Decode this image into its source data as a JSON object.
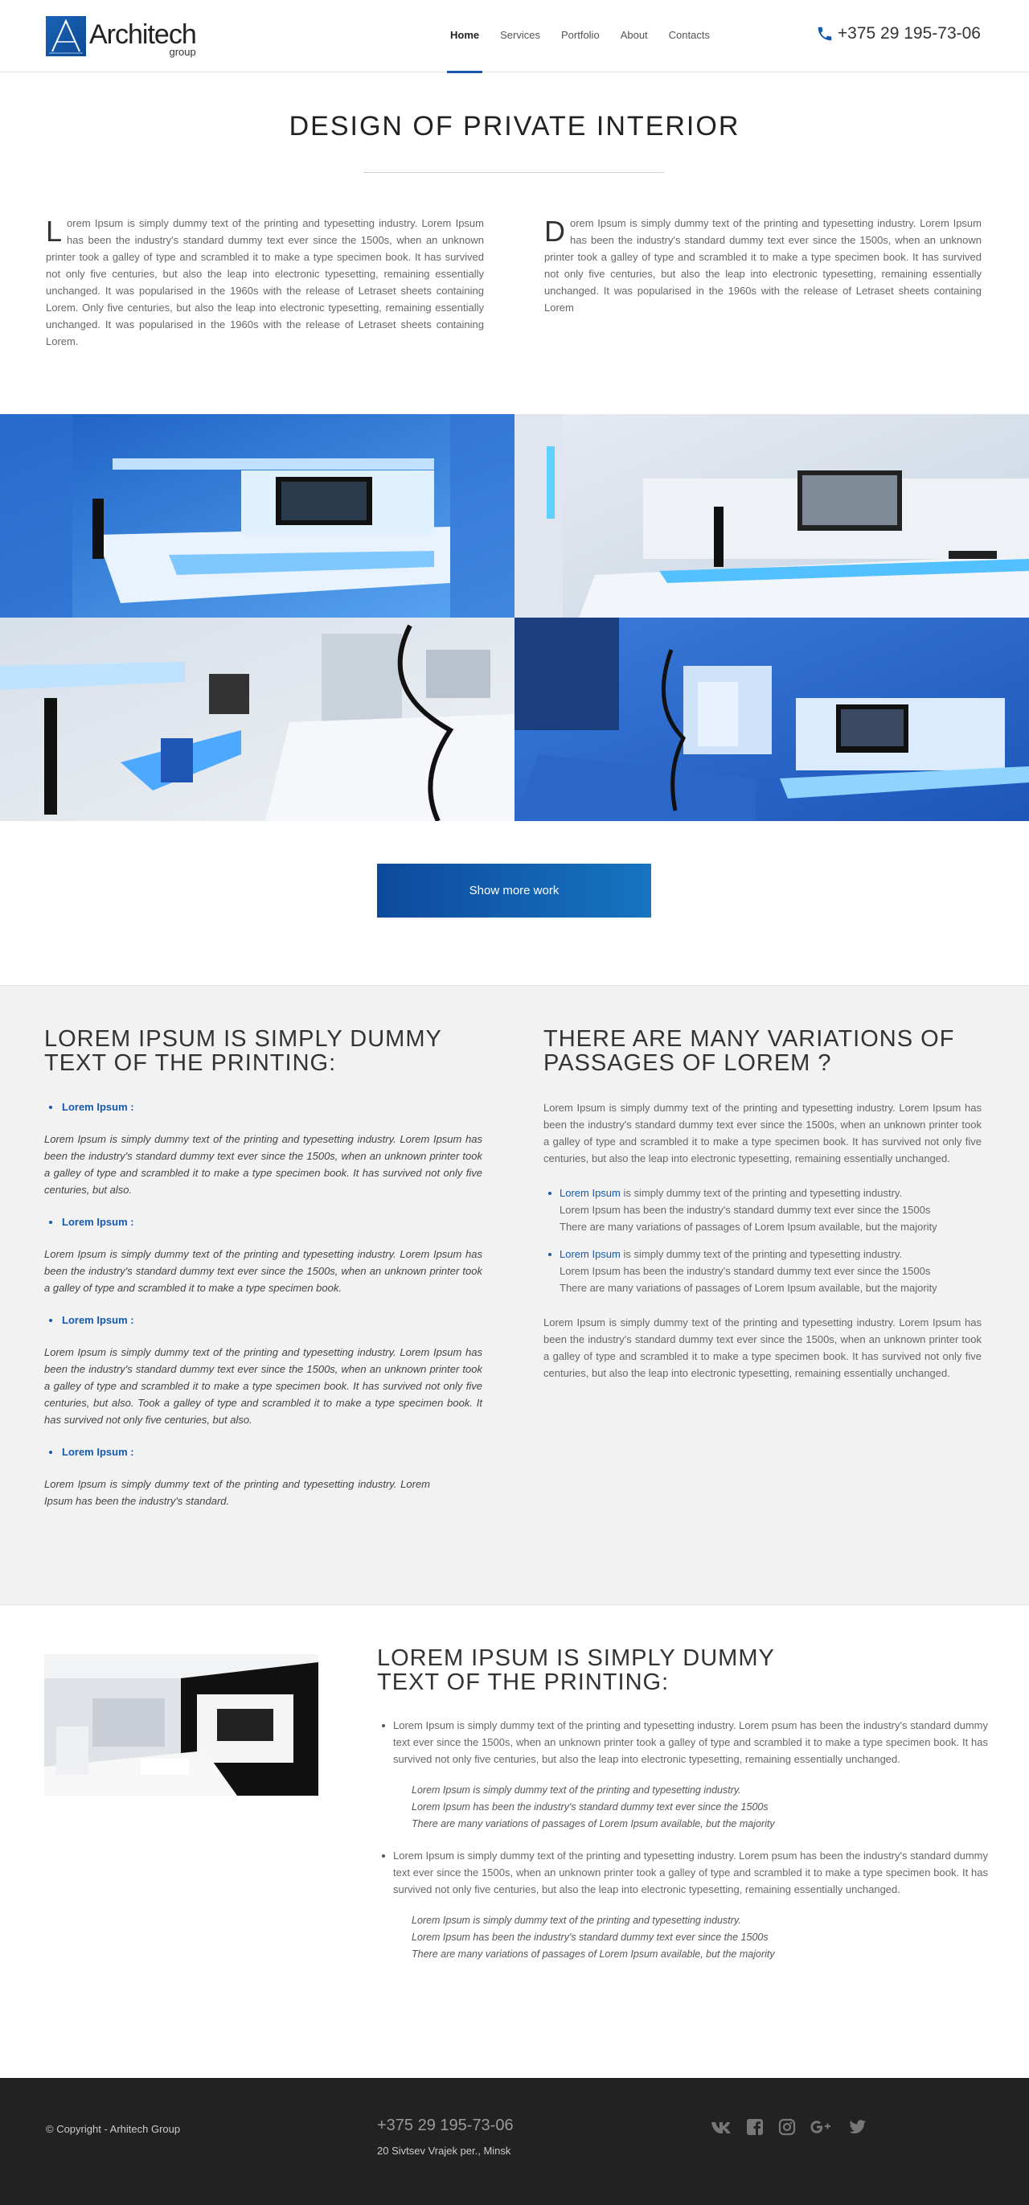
{
  "logo": {
    "name": "Architech",
    "sub": "group"
  },
  "nav": {
    "items": [
      {
        "label": "Home"
      },
      {
        "label": "Services"
      },
      {
        "label": "Portfolio"
      },
      {
        "label": "About"
      },
      {
        "label": "Contacts"
      }
    ]
  },
  "header": {
    "phone": "+375 29 195-73-06"
  },
  "intro": {
    "title": "DESIGN OF PRIVATE INTERIOR",
    "left_drop": "L",
    "left_text": "orem Ipsum is simply dummy text of the printing and typesetting industry. Lorem Ipsum has been the industry's standard dummy text ever since the 1500s, when an unknown printer took a galley of type and scrambled it to make a type specimen book. It has survived not only five centuries, but also the leap into electronic typesetting, remaining essentially unchanged. It was popularised in the 1960s with the release of Letraset sheets containing Lorem. Only five centuries, but also the leap into electronic typesetting, remaining essentially unchanged. It was popularised in the 1960s with the release of Letraset sheets containing Lorem.",
    "right_drop": "D",
    "right_text": "orem Ipsum is simply dummy text of the printing and typesetting industry. Lorem Ipsum has been the industry's standard dummy text ever since the 1500s, when an unknown printer took a galley of type and scrambled it to make a type specimen book. It has survived not only five centuries, but also the leap into electronic typesetting, remaining essentially unchanged. It was popularised in the 1960s with the release of Letraset sheets containing Lorem"
  },
  "gallery": {
    "button": "Show more work"
  },
  "left_block": {
    "heading": "LOREM IPSUM IS SIMPLY DUMMY TEXT OF THE PRINTING:",
    "items": [
      {
        "label": "Lorem Ipsum :",
        "text": "Lorem Ipsum is simply dummy text of the printing and typesetting industry. Lorem Ipsum has been the industry's standard dummy text ever since the 1500s, when an unknown printer took a galley of type and scrambled it to make a type specimen book. It has survived not only five centuries, but also."
      },
      {
        "label": "Lorem Ipsum :",
        "text": "Lorem Ipsum is simply dummy text of the printing and typesetting industry. Lorem Ipsum has been the industry's standard dummy text ever since the 1500s, when an unknown printer took a galley of type and scrambled it to make a type specimen book."
      },
      {
        "label": "Lorem Ipsum :",
        "text": "Lorem Ipsum is simply dummy text of the printing and typesetting industry. Lorem Ipsum has been the industry's standard dummy text ever since the 1500s, when an unknown printer took a galley of type and scrambled it to make a type specimen book. It has survived not only five centuries, but also. Took a galley of type and scrambled it to make a type specimen book. It has survived not only five centuries, but also."
      },
      {
        "label": "Lorem Ipsum :",
        "text": "Lorem Ipsum is simply dummy text of the printing and typesetting industry. Lorem Ipsum has been the industry's standard."
      }
    ]
  },
  "right_block": {
    "heading": "THERE ARE MANY VARIATIONS OF PASSAGES OF LOREM ?",
    "para1": "Lorem Ipsum is simply dummy text of the printing and typesetting industry. Lorem Ipsum has been the industry's standard dummy text ever since the 1500s, when an unknown printer took a galley of type and scrambled it to make a type specimen book. It has survived not only five centuries, but also the leap into electronic typesetting, remaining essentially unchanged.",
    "items": [
      {
        "link": "Lorem Ipsum",
        "text": " is simply dummy text of the printing and typesetting industry.",
        "line2": "Lorem  Ipsum has been the industry's standard dummy text ever since the 1500s",
        "line3": "There are many variations of passages of Lorem Ipsum available, but the majority"
      },
      {
        "link": "Lorem Ipsum",
        "text": " is simply dummy text of the printing and typesetting industry.",
        "line2": "Lorem  Ipsum has been the industry's standard dummy text ever since the 1500s",
        "line3": "There are many variations of passages of Lorem Ipsum available, but the majority"
      }
    ],
    "para2": "Lorem Ipsum is simply dummy text of the printing and typesetting industry. Lorem Ipsum has been the industry's standard dummy text ever since the 1500s, when an unknown printer took a galley of type and scrambled it to make a type specimen book. It has survived not only five centuries, but also the leap into electronic typesetting, remaining essentially unchanged."
  },
  "lower_block": {
    "heading": "LOREM IPSUM IS SIMPLY DUMMY TEXT OF THE PRINTING:",
    "items": [
      {
        "text": "Lorem Ipsum is simply dummy text of the printing and typesetting industry. Lorem psum has been the industry's standard dummy text ever since the 1500s, when an unknown printer took a galley of type and scrambled it to make a type specimen book. It has survived not only five centuries, but also the leap into electronic typesetting, remaining essentially unchanged.",
        "q1": "Lorem Ipsum is simply dummy text of the printing and typesetting industry.",
        "q2": "Lorem  Ipsum has been the industry's standard dummy text ever since the 1500s",
        "q3": "There are many variations of passages of Lorem Ipsum available, but the majority"
      },
      {
        "text": "Lorem Ipsum is simply dummy text of the printing and typesetting industry. Lorem psum has been the industry's standard dummy text ever since the 1500s, when an unknown printer took a galley of type and scrambled it to make a type specimen book. It has survived not only five centuries, but also the leap into electronic typesetting, remaining essentially unchanged.",
        "q1": "Lorem Ipsum is simply dummy text of the printing and typesetting industry.",
        "q2": "Lorem  Ipsum has been the industry's standard dummy text ever since the 1500s",
        "q3": "There are many variations of passages of Lorem Ipsum available, but the majority"
      }
    ]
  },
  "footer": {
    "copyright": "© Copyright - Arhitech Group",
    "phone": "+375 29 195-73-06",
    "address": "20 Sivtsev Vrajek per., Minsk",
    "social": [
      "vk-icon",
      "facebook-icon",
      "instagram-icon",
      "google-plus-icon",
      "twitter-icon"
    ]
  },
  "colors": {
    "accent": "#1659ad",
    "footer_bg": "#222222",
    "section_bg": "#f2f2f2"
  }
}
